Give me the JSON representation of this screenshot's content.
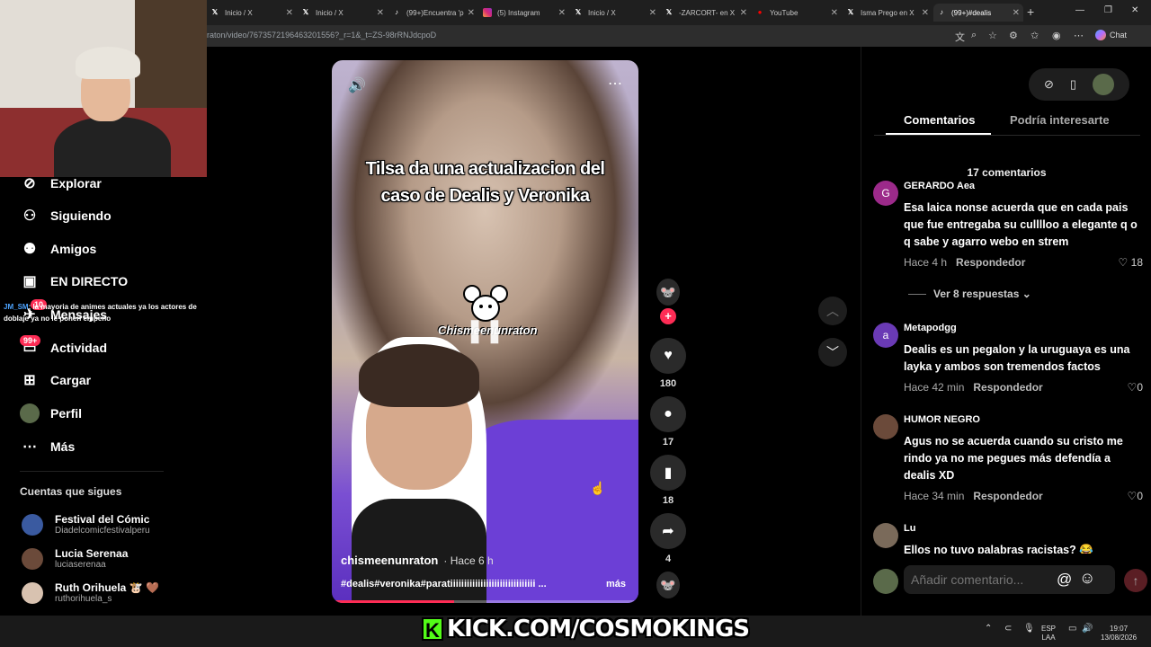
{
  "browser": {
    "tabs": [
      {
        "label": "Inicio / X",
        "icon": "x-logo-icon"
      },
      {
        "label": "Inicio / X",
        "icon": "x-logo-icon"
      },
      {
        "label": "(99+)Encuentra 'p",
        "icon": "tiktok-icon"
      },
      {
        "label": "(5) Instagram",
        "icon": "instagram-icon"
      },
      {
        "label": "Inicio / X",
        "icon": "x-logo-icon"
      },
      {
        "label": "-ZARCORT- en X",
        "icon": "x-logo-icon"
      },
      {
        "label": "YouTube",
        "icon": "youtube-icon"
      },
      {
        "label": "Isma Prego en X",
        "icon": "x-logo-icon"
      },
      {
        "label": "(99+)#dealis",
        "icon": "tiktok-icon"
      }
    ],
    "url": "raton/video/7673572196463201556?_r=1&_t=ZS-98rRNJdcpoD",
    "chat_label": "Chat"
  },
  "sidebar": {
    "nav": [
      {
        "label": "Explorar",
        "icon": "compass-icon"
      },
      {
        "label": "Siguiendo",
        "icon": "person-follow-icon"
      },
      {
        "label": "Amigos",
        "icon": "friends-icon"
      },
      {
        "label": "EN DIRECTO",
        "icon": "live-tv-icon"
      },
      {
        "label": "Mensajes",
        "icon": "message-icon"
      },
      {
        "label": "Actividad",
        "icon": "inbox-icon"
      },
      {
        "label": "Cargar",
        "icon": "upload-icon"
      },
      {
        "label": "Perfil",
        "icon": "profile-avatar"
      },
      {
        "label": "Más",
        "icon": "more-dots-icon"
      }
    ],
    "badges": {
      "mensajes": "10",
      "actividad": "99+"
    },
    "overlay_chat": {
      "name": "JM_SM",
      "text": "la mayoria de animes actuales ya los actores de doblaje ya no le ponen empeño"
    },
    "following_title": "Cuentas que sigues",
    "following": [
      {
        "name": "Festival del Cómic",
        "handle": "Diadelcomicfestivalperu"
      },
      {
        "name": "Lucia Serenaa",
        "handle": "luciaserenaa"
      },
      {
        "name": "Ruth Orihuela 🐮 🤎",
        "handle": "ruthorihuela_s"
      }
    ]
  },
  "video": {
    "caption_line1": "Tilsa da una actualizacion  del",
    "caption_line2": "caso de Dealis y Veronika",
    "watermark": "Chismeenunraton",
    "author": "chismeenunraton",
    "time": "· Hace 6 h",
    "description": "#dealis#veronika#paratiiiiiiiiiiiiiiiiiiiiiiiiiiiiiii ...",
    "more": "más",
    "progress": 0.4
  },
  "actions": {
    "likes": "180",
    "comments": "17",
    "saves": "18",
    "shares": "4"
  },
  "right_panel": {
    "tab_comments": "Comentarios",
    "tab_interest": "Podría interesarte",
    "comment_count": "17 comentarios",
    "comments": [
      {
        "avatar": "G",
        "avatar_color": "#9c2a8a",
        "name": "GERARDO Aea",
        "text": "Esa laica nonse acuerda que en cada pais que fue entregaba su culllloo a elegante q o q sabe y agarro webo en strem",
        "time": "Hace 4 h",
        "reply": "Respondedor",
        "likes": "18"
      },
      {
        "avatar": "a",
        "avatar_color": "#6a3ab5",
        "name": "Metapodgg",
        "text": "Dealis es un pegalon y la uruguaya es una layka y ambos son tremendos factos",
        "time": "Hace 42 min",
        "reply": "Respondedor",
        "likes": "0"
      },
      {
        "avatar": "",
        "avatar_color": "#6b4a3a",
        "name": "HUMOR NEGRO",
        "text": "Agus no se acuerda cuando su cristo me rindo ya no me pegues más defendía a dealis XD",
        "time": "Hace 34 min",
        "reply": "Respondedor",
        "likes": "0"
      },
      {
        "avatar": "",
        "avatar_color": "#7a6a5a",
        "name": "Lu",
        "text": "Ellos no tuvo palabras racistas? 😂",
        "time": "",
        "reply": "",
        "likes": ""
      }
    ],
    "more_replies": "Ver 8 respuestas",
    "composer_placeholder": "Añadir comentario...",
    "at_symbol": "@"
  },
  "stream": {
    "kick_url": "KICK.COM/COSMOKINGS"
  },
  "taskbar": {
    "lang_top": "ESP",
    "lang_bottom": "LAA",
    "time": "19:07",
    "date": "13/08/2026"
  }
}
